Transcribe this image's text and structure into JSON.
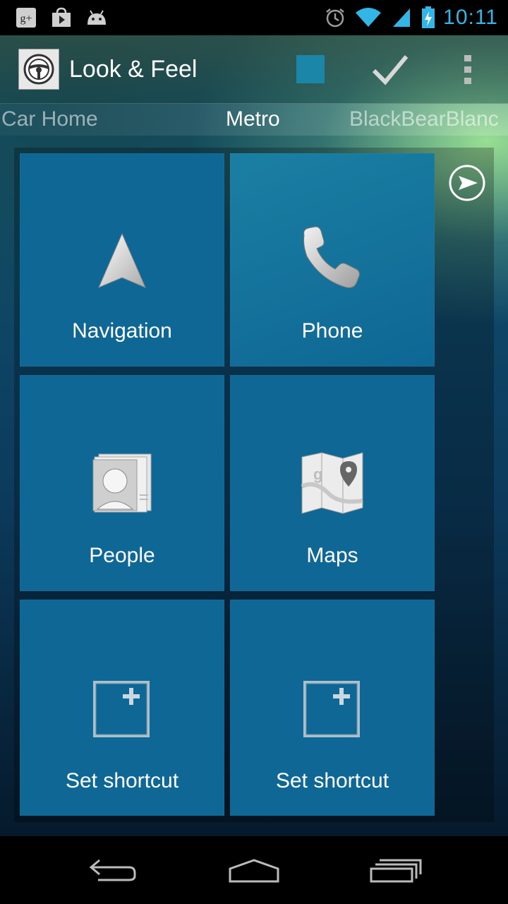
{
  "status_bar": {
    "time": "10:11",
    "left_icons": [
      "google-plus-icon",
      "play-store-icon",
      "android-debug-icon"
    ],
    "right_icons": [
      "alarm-icon",
      "wifi-icon",
      "signal-icon",
      "battery-charging-icon"
    ],
    "time_color": "#33b5e5"
  },
  "action_bar": {
    "title": "Look & Feel",
    "swatch_color": "#1b86a8"
  },
  "theme_tabs": {
    "previous": "Car Home",
    "current": "Metro",
    "next": "BlackBearBlanc"
  },
  "tiles": [
    {
      "label": "Navigation",
      "icon": "navigation-arrow-icon"
    },
    {
      "label": "Phone",
      "icon": "phone-handset-icon"
    },
    {
      "label": "People",
      "icon": "contacts-card-icon"
    },
    {
      "label": "Maps",
      "icon": "maps-icon"
    },
    {
      "label": "Set shortcut",
      "icon": "add-shortcut-icon"
    },
    {
      "label": "Set shortcut",
      "icon": "add-shortcut-icon"
    }
  ],
  "colors": {
    "tile": "#0e6794",
    "accent": "#33b5e5"
  }
}
